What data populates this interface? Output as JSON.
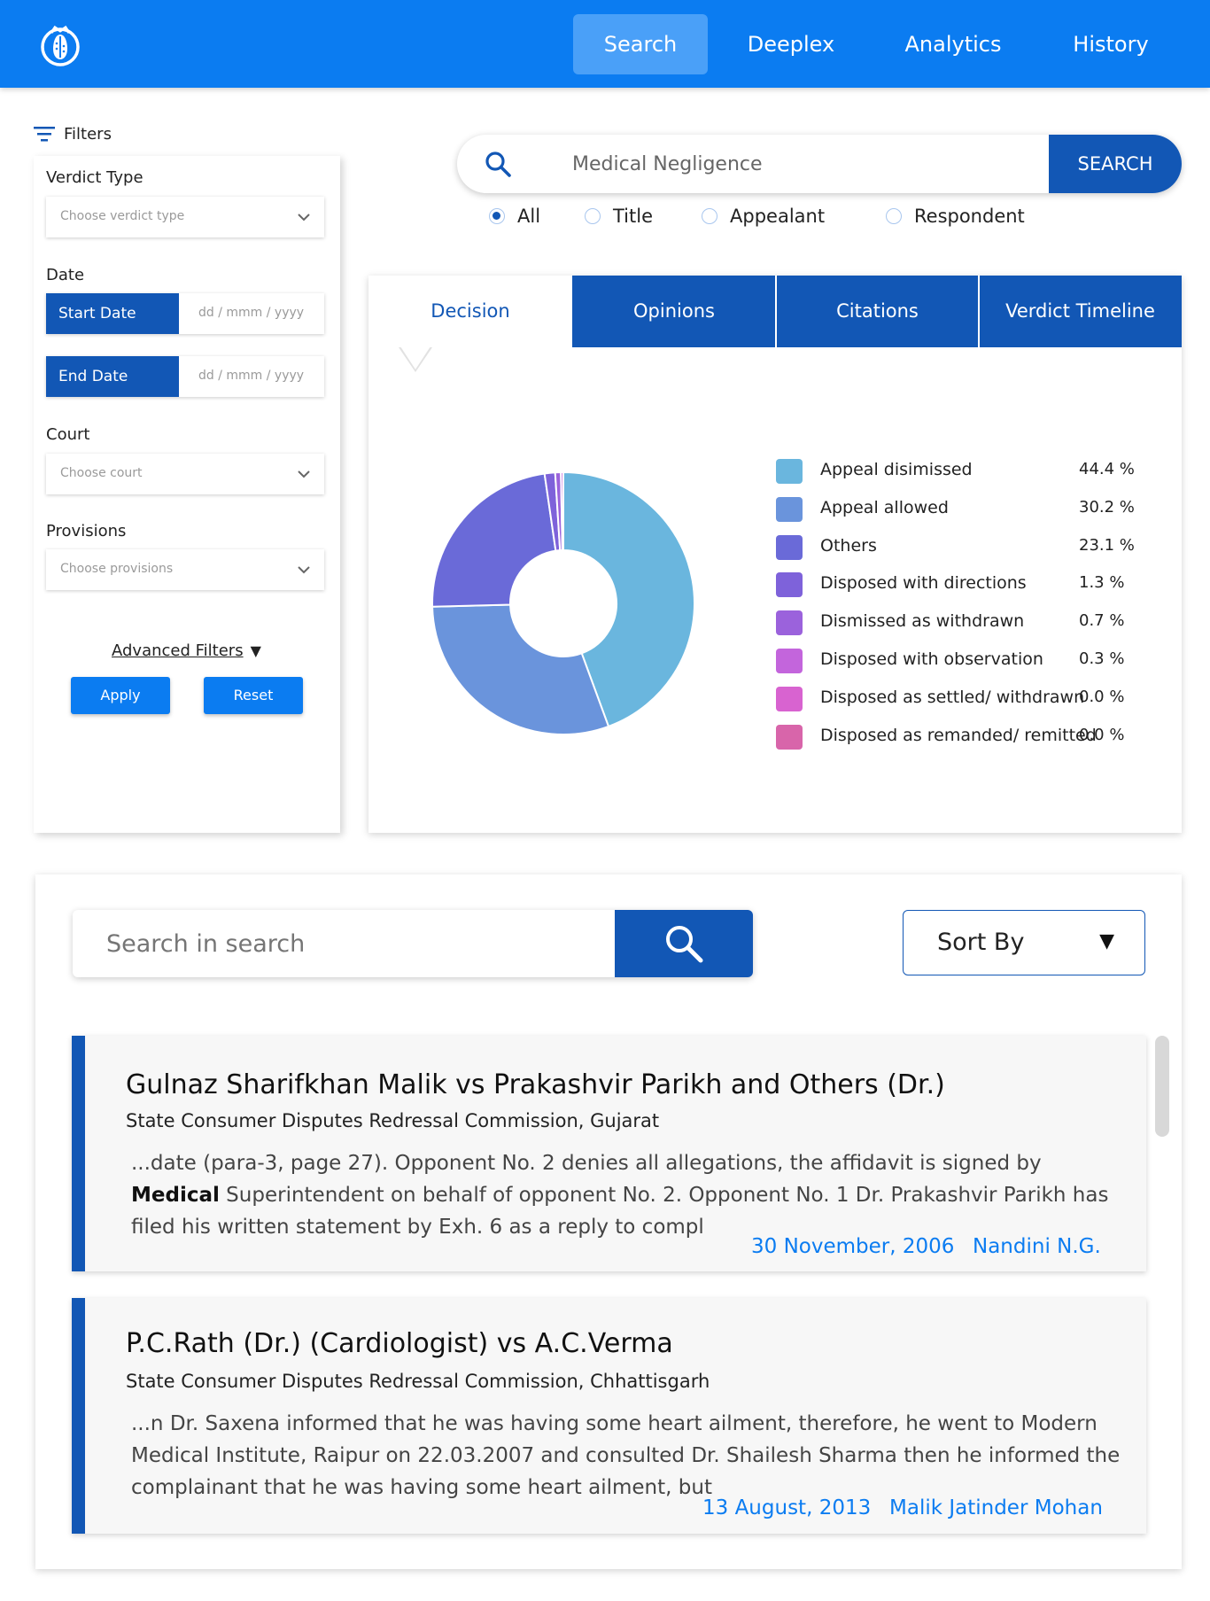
{
  "nav": {
    "items": [
      {
        "label": "Search",
        "active": true
      },
      {
        "label": "Deeplex",
        "active": false
      },
      {
        "label": "Analytics",
        "active": false
      },
      {
        "label": "History",
        "active": false
      }
    ]
  },
  "filters": {
    "title": "Filters",
    "verdict_type": {
      "label": "Verdict Type",
      "placeholder": "Choose verdict type"
    },
    "date": {
      "label": "Date",
      "start_label": "Start Date",
      "end_label": "End Date",
      "placeholder": "dd / mmm / yyyy"
    },
    "court": {
      "label": "Court",
      "placeholder": "Choose court"
    },
    "provisions": {
      "label": "Provisions",
      "placeholder": "Choose provisions"
    },
    "advanced": "Advanced Filters",
    "apply": "Apply",
    "reset": "Reset"
  },
  "search": {
    "query": "Medical Negligence",
    "button": "SEARCH",
    "options": [
      {
        "label": "All",
        "selected": true
      },
      {
        "label": "Title",
        "selected": false
      },
      {
        "label": "Appealant",
        "selected": false
      },
      {
        "label": "Respondent",
        "selected": false
      }
    ]
  },
  "tabs": [
    {
      "label": "Decision",
      "active": true
    },
    {
      "label": "Opinions",
      "active": false
    },
    {
      "label": "Citations",
      "active": false
    },
    {
      "label": "Verdict Timeline",
      "active": false
    }
  ],
  "chart_data": {
    "type": "pie",
    "categories": [
      "Appeal disimissed",
      "Appeal allowed",
      "Others",
      "Disposed with directions",
      "Dismissed as withdrawn",
      "Disposed with observation",
      "Disposed as settled/ withdrawn",
      "Disposed as remanded/ remitted"
    ],
    "values": [
      44.4,
      30.2,
      23.1,
      1.3,
      0.7,
      0.3,
      0.0,
      0.0
    ],
    "labels": [
      "44.4 %",
      "30.2 %",
      "23.1 %",
      "1.3 %",
      "0.7 %",
      "0.3 %",
      "0.0 %",
      "0.0 %"
    ],
    "colors": [
      "#6ab6de",
      "#6a94dc",
      "#6a6ad8",
      "#7e62da",
      "#9b62dc",
      "#c365dc",
      "#d863d0",
      "#d865aa"
    ],
    "donut": true,
    "legend": "right"
  },
  "results": {
    "search_placeholder": "Search in search",
    "sort_label": "Sort By",
    "items": [
      {
        "title": "Gulnaz Sharifkhan Malik vs Prakashvir Parikh and Others (Dr.)",
        "court": "State Consumer Disputes Redressal Commission, Gujarat",
        "snippet_before": "...date (para-3, page 27). Opponent No. 2 denies all allegations, the affidavit is signed by ",
        "snippet_bold": "Medical",
        "snippet_after": " Superintendent on behalf of opponent No. 2. Opponent No. 1 Dr. Prakashvir Parikh has filed his written statement by Exh. 6 as a reply to compl",
        "date": "30 November, 2006",
        "author": "Nandini N.G."
      },
      {
        "title": "P.C.Rath (Dr.) (Cardiologist) vs A.C.Verma",
        "court": "State Consumer Disputes Redressal Commission, Chhattisgarh",
        "snippet_before": "...n Dr. Saxena informed that he was having some heart ailment, therefore, he went to Modern Medical Institute, Raipur on 22.03.2007 and consulted Dr. Shailesh Sharma then he informed the complainant that he was having some heart ailment, but",
        "snippet_bold": "",
        "snippet_after": "",
        "date": "13 August, 2013",
        "author": "Malik Jatinder Mohan"
      }
    ]
  }
}
